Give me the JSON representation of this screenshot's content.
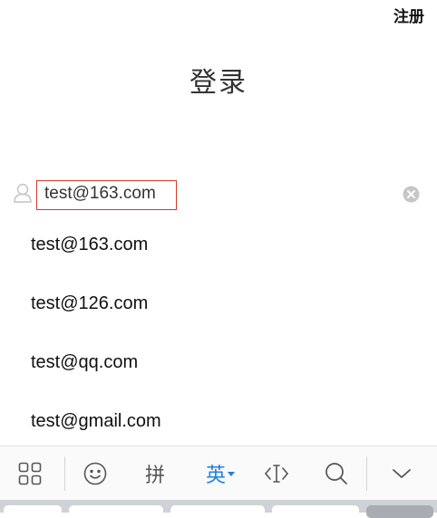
{
  "header": {
    "register_label": "注册",
    "title": "登录"
  },
  "account": {
    "value": "test@163.com",
    "icon": "user-icon",
    "clear_icon": "clear-icon"
  },
  "suggestions": [
    "test@163.com",
    "test@126.com",
    "test@qq.com",
    "test@gmail.com"
  ],
  "keyboard_toolbar": {
    "items": [
      {
        "name": "grid-menu",
        "icon": "grid-icon"
      },
      {
        "name": "emoji",
        "icon": "smiley-icon"
      },
      {
        "name": "pinyin",
        "label": "拼"
      },
      {
        "name": "english",
        "label": "英",
        "active": true
      },
      {
        "name": "cursor",
        "icon": "text-cursor-icon"
      },
      {
        "name": "search",
        "icon": "search-icon"
      },
      {
        "name": "collapse",
        "icon": "chevron-down-icon"
      }
    ],
    "active_color": "#1f7fe0"
  },
  "accent_color": "#d33a2c"
}
